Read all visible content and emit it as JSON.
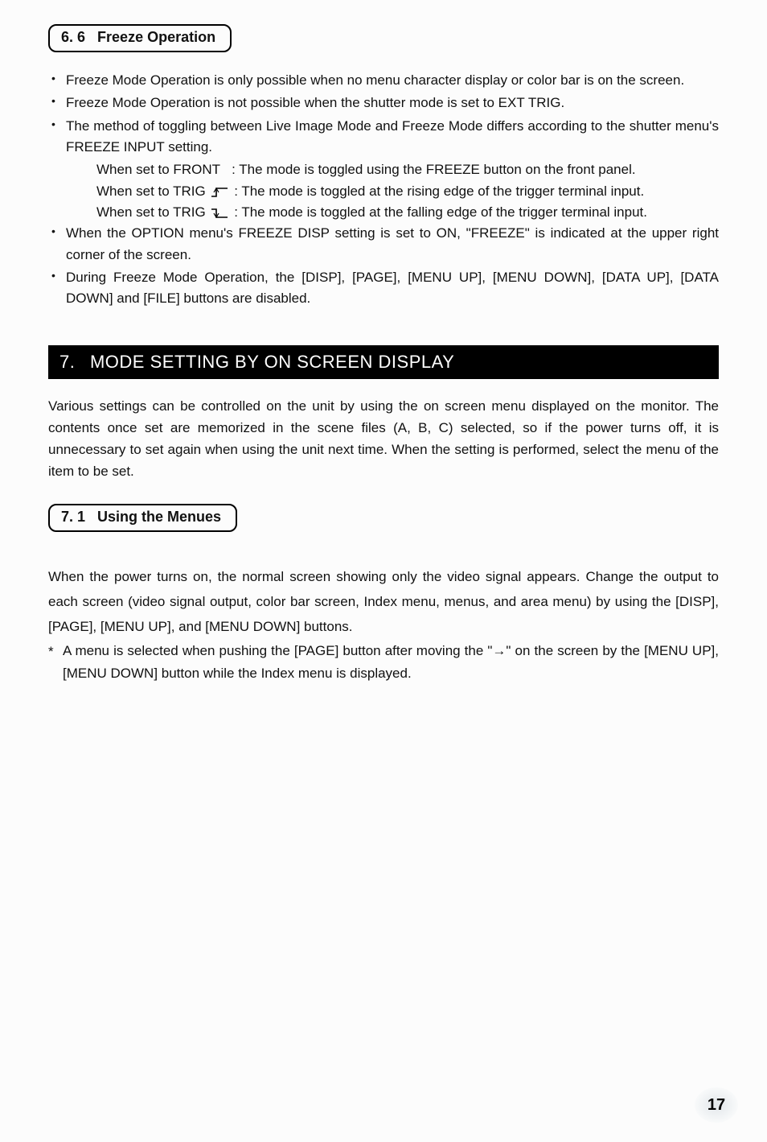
{
  "section66": {
    "number": "6. 6",
    "title": "Freeze Operation"
  },
  "bullets66": [
    "Freeze Mode Operation is only possible when no menu character display or color bar is on the screen.",
    "Freeze Mode Operation is not possible when the shutter mode is set to EXT TRIG.",
    "The method of toggling between Live Image Mode and Freeze Mode differs according to the shutter menu's FREEZE INPUT setting."
  ],
  "subrows": {
    "front_label": "When set to FRONT",
    "front_text": ": The mode is toggled using the FREEZE button on the front panel.",
    "trig_rise_label": "When set to TRIG",
    "trig_rise_text": ": The mode is toggled at the rising edge of the trigger terminal input.",
    "trig_fall_label": "When set to TRIG",
    "trig_fall_text": ": The mode is toggled at the falling edge of the trigger terminal input."
  },
  "bullets66b": [
    "When the OPTION menu's FREEZE DISP setting is set to ON, \"FREEZE\" is indicated at the upper right corner of the screen.",
    "During Freeze Mode Operation, the [DISP], [PAGE], [MENU UP], [MENU DOWN], [DATA UP], [DATA DOWN] and [FILE] buttons are disabled."
  ],
  "banner7": {
    "number": "7.",
    "title": "MODE SETTING BY ON SCREEN DISPLAY"
  },
  "para7": "Various settings can be controlled on the unit by using the on screen menu displayed on the monitor. The contents once set are memorized in the scene files (A, B, C) selected, so if the power turns off, it is unnecessary to set again when using the unit next time. When the setting is performed, select the menu of the item to be set.",
  "section71": {
    "number": "7. 1",
    "title": "Using the Menues"
  },
  "para71a": "When the power turns on, the normal screen showing only the video signal appears. Change the output to each screen (video signal output, color bar screen, Index menu, menus, and area menu) by using the [DISP], [PAGE], [MENU UP], and [MENU DOWN] buttons.",
  "star71": "A menu is selected when pushing the [PAGE] button after moving the \"→\" on the screen by the [MENU UP], [MENU DOWN] button while the Index menu is displayed.",
  "page_number": "17"
}
